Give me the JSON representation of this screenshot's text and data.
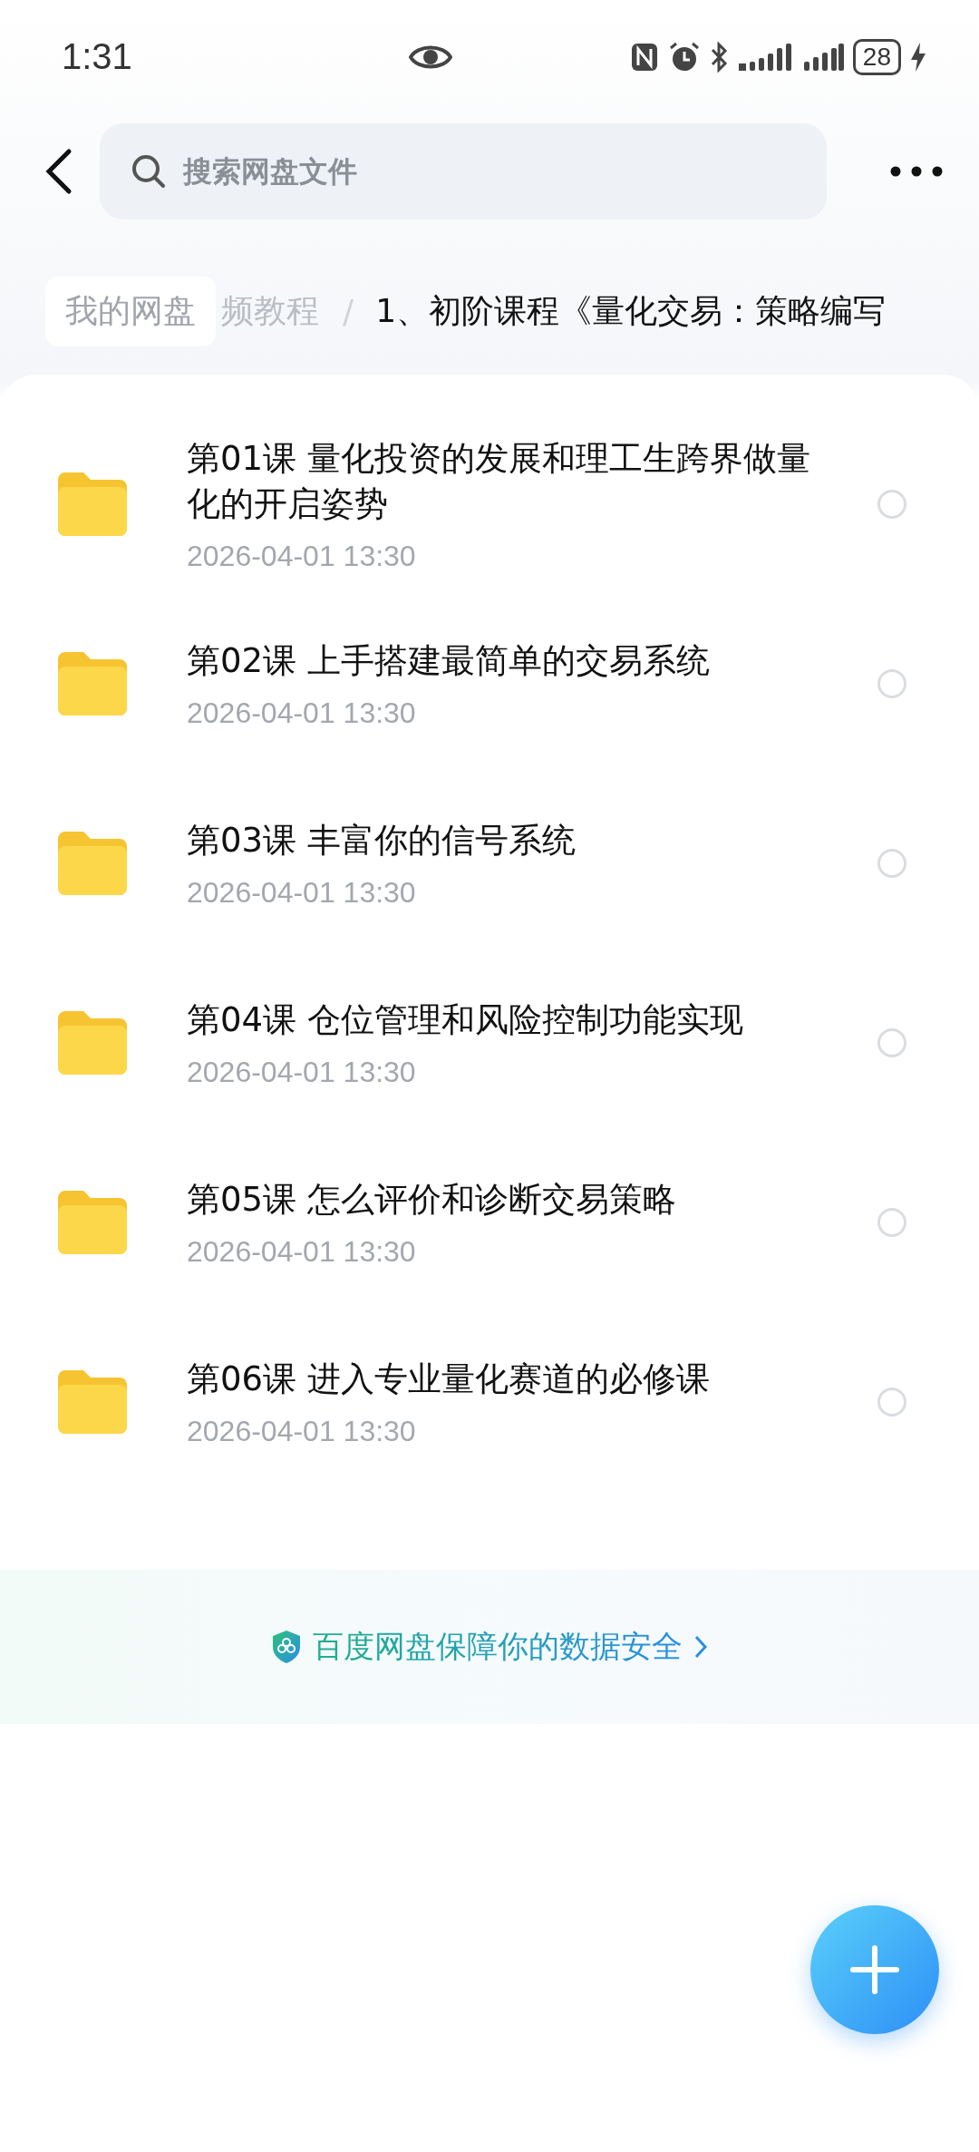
{
  "status_bar": {
    "time": "1:31",
    "battery": "28"
  },
  "search": {
    "placeholder": "搜索网盘文件"
  },
  "breadcrumb": [
    {
      "label": "我的网盘",
      "kind": "root"
    },
    {
      "label": "频教程",
      "kind": "faded"
    },
    {
      "label": "/",
      "kind": "separator"
    },
    {
      "label": "1、初阶课程《量化交易：策略编写",
      "kind": "current"
    }
  ],
  "files": [
    {
      "name": "第01课 量化投资的发展和理工生跨界做量化的开启姿势",
      "date": "2026-04-01  13:30",
      "selected": false
    },
    {
      "name": "第02课 上手搭建最简单的交易系统",
      "date": "2026-04-01  13:30",
      "selected": false
    },
    {
      "name": "第03课 丰富你的信号系统",
      "date": "2026-04-01  13:30",
      "selected": false
    },
    {
      "name": "第04课 仓位管理和风险控制功能实现",
      "date": "2026-04-01  13:30",
      "selected": false
    },
    {
      "name": "第05课 怎么评价和诊断交易策略",
      "date": "2026-04-01  13:30",
      "selected": false
    },
    {
      "name": "第06课 进入专业量化赛道的必修课",
      "date": "2026-04-01  13:30",
      "selected": false
    }
  ],
  "security_notice": "百度网盘保障你的数据安全"
}
